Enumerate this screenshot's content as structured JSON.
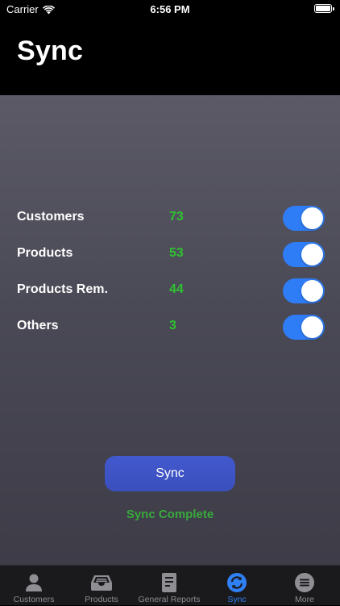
{
  "status_bar": {
    "carrier": "Carrier",
    "time": "6:56 PM"
  },
  "header": {
    "title": "Sync"
  },
  "sync_items": [
    {
      "label": "Customers",
      "count": "73",
      "enabled": true
    },
    {
      "label": "Products",
      "count": "53",
      "enabled": true
    },
    {
      "label": "Products Rem.",
      "count": "44",
      "enabled": true
    },
    {
      "label": "Others",
      "count": "3",
      "enabled": true
    }
  ],
  "sync_button": {
    "label": "Sync"
  },
  "sync_status": "Sync Complete",
  "tab_bar": {
    "tabs": [
      {
        "label": "Customers",
        "icon": "person-icon",
        "active": false
      },
      {
        "label": "Products",
        "icon": "tray-icon",
        "active": false
      },
      {
        "label": "General Reports",
        "icon": "document-icon",
        "active": false
      },
      {
        "label": "Sync",
        "icon": "sync-icon",
        "active": true
      },
      {
        "label": "More",
        "icon": "more-icon",
        "active": false
      }
    ]
  },
  "colors": {
    "accent_blue": "#2f7df6",
    "count_green": "#2ec231",
    "status_green": "#39a93c",
    "button_blue": "#3f55c8"
  }
}
